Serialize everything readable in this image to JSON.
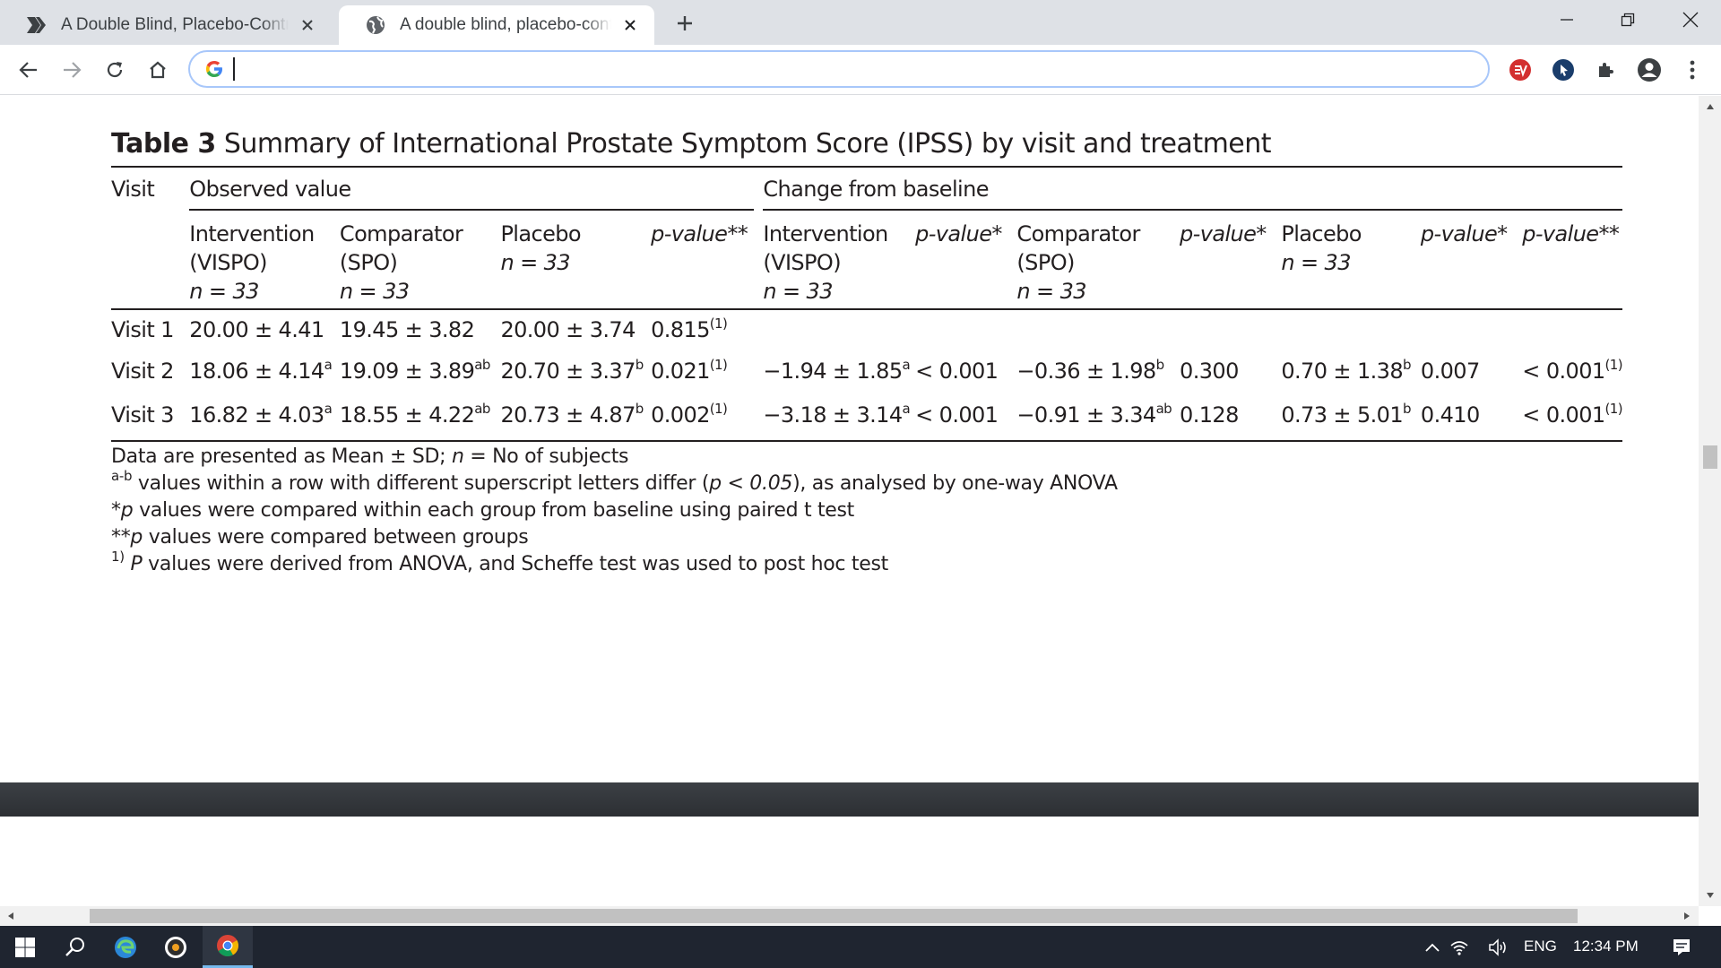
{
  "browser": {
    "tabs": [
      {
        "title": "A Double Blind, Placebo-Controlled",
        "active": false
      },
      {
        "title": "A double blind, placebo-controlled",
        "active": true
      }
    ],
    "address_value": ""
  },
  "article": {
    "table_label": "Table 3",
    "table_caption": "Summary of International Prostate Symptom Score (IPSS) by visit and treatment",
    "header": {
      "visit": "Visit",
      "observed": "Observed value",
      "change": "Change from baseline",
      "obs_int_1": "Intervention",
      "obs_int_2": "(VISPO)",
      "obs_int_3": "n = 33",
      "obs_comp_1": "Comparator",
      "obs_comp_2": "(SPO)",
      "obs_comp_3": "n = 33",
      "obs_plac_1": "Placebo",
      "obs_plac_2": "n = 33",
      "obs_pval": "p-value**",
      "chg_int_1": "Intervention",
      "chg_int_2": "(VISPO)",
      "chg_int_3": "n = 33",
      "chg_int_p": "p-value*",
      "chg_comp_1": "Comparator",
      "chg_comp_2": "(SPO)",
      "chg_comp_3": "n = 33",
      "chg_comp_p": "p-value*",
      "chg_plac_1": "Placebo",
      "chg_plac_2": "n = 33",
      "chg_plac_p": "p-value*",
      "chg_pval": "p-value**"
    },
    "rows": [
      {
        "visit": "Visit 1",
        "obs_int": "20.00 ± 4.41",
        "obs_int_sup": "",
        "obs_comp": "19.45 ± 3.82",
        "obs_comp_sup": "",
        "obs_plac": "20.00 ± 3.74",
        "obs_plac_sup": "",
        "obs_p": "0.815",
        "obs_p_sup": "(1)",
        "chg_int": "",
        "chg_int_sup": "",
        "chg_int_p": "",
        "chg_comp": "",
        "chg_comp_sup": "",
        "chg_comp_p": "",
        "chg_plac": "",
        "chg_plac_sup": "",
        "chg_plac_p": "",
        "chg_p": "",
        "chg_p_sup": ""
      },
      {
        "visit": "Visit 2",
        "obs_int": "18.06 ± 4.14",
        "obs_int_sup": "a",
        "obs_comp": "19.09 ± 3.89",
        "obs_comp_sup": "ab",
        "obs_plac": "20.70 ± 3.37",
        "obs_plac_sup": "b",
        "obs_p": "0.021",
        "obs_p_sup": "(1)",
        "chg_int": "−1.94 ± 1.85",
        "chg_int_sup": "a",
        "chg_int_p": "< 0.001",
        "chg_comp": "−0.36 ± 1.98",
        "chg_comp_sup": "b",
        "chg_comp_p": "0.300",
        "chg_plac": "0.70 ± 1.38",
        "chg_plac_sup": "b",
        "chg_plac_p": "0.007",
        "chg_p": "< 0.001",
        "chg_p_sup": "(1)"
      },
      {
        "visit": "Visit 3",
        "obs_int": "16.82 ± 4.03",
        "obs_int_sup": "a",
        "obs_comp": "18.55 ± 4.22",
        "obs_comp_sup": "ab",
        "obs_plac": "20.73 ± 4.87",
        "obs_plac_sup": "b",
        "obs_p": "0.002",
        "obs_p_sup": "(1)",
        "chg_int": "−3.18 ± 3.14",
        "chg_int_sup": "a",
        "chg_int_p": "< 0.001",
        "chg_comp": "−0.91 ± 3.34",
        "chg_comp_sup": "ab",
        "chg_comp_p": "0.128",
        "chg_plac": "0.73 ± 5.01",
        "chg_plac_sup": "b",
        "chg_plac_p": "0.410",
        "chg_p": "< 0.001",
        "chg_p_sup": "(1)"
      }
    ],
    "notes": {
      "n1_a": "Data are presented as Mean ± SD; ",
      "n1_b": "n",
      "n1_c": " = No of subjects",
      "n2_sup": "a-b",
      "n2_a": " values within a row with different superscript letters differ (",
      "n2_b": "p < 0.05",
      "n2_c": "), as analysed by one-way ANOVA",
      "n3_a": "*",
      "n3_b": "p",
      "n3_c": " values were compared within each group from baseline using paired t test",
      "n4_a": "**",
      "n4_b": "p",
      "n4_c": " values were compared between groups",
      "n5_sup": "1)",
      "n5_a": " ",
      "n5_b": "P",
      "n5_c": " values were derived from ANOVA, and Scheffe test was used to post hoc test"
    }
  },
  "taskbar": {
    "language": "ENG",
    "time": "12:34 PM"
  },
  "colors": {
    "tabstrip": "#dee1e6",
    "omnibox_border": "#a8c7fa",
    "taskbar": "#1f2530",
    "text": "#231f20"
  }
}
